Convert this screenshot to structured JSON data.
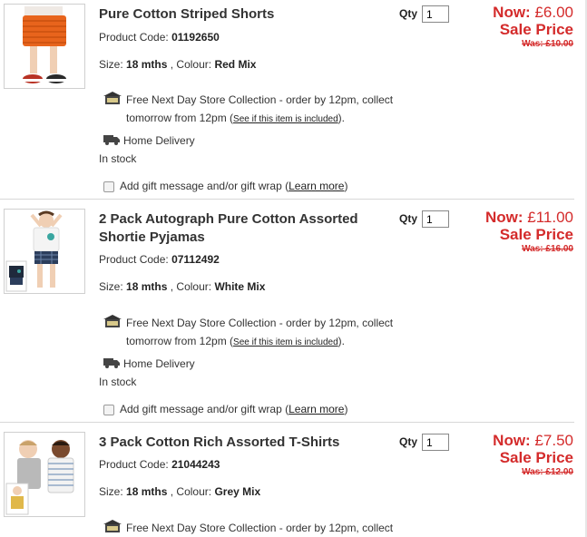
{
  "labels": {
    "qty": "Qty",
    "now": "Now:",
    "sale": "Sale Price",
    "code_label": "Product Code:",
    "size_label": "Size:",
    "colour_label": "Colour:",
    "collection_text_1": "Free Next Day Store Collection - order by 12pm, collect",
    "collection_text_2": "tomorrow from 12pm (",
    "see_link": "See if this item is included",
    "collection_close": ").",
    "home_delivery": "Home Delivery",
    "in_stock": "In stock",
    "gift_text": "Add gift message and/or gift wrap (",
    "learn_more": "Learn more",
    "gift_close": ")"
  },
  "items": [
    {
      "title": "Pure Cotton Striped Shorts",
      "code": "01192650",
      "size": "18 mths",
      "colour": "Red Mix",
      "qty": "1",
      "now_price": "£6.00",
      "was_price": "Was: £10.00"
    },
    {
      "title": "2 Pack Autograph Pure Cotton Assorted Shortie Pyjamas",
      "code": "07112492",
      "size": "18 mths",
      "colour": "White Mix",
      "qty": "1",
      "now_price": "£11.00",
      "was_price": "Was: £16.00"
    },
    {
      "title": "3 Pack Cotton Rich Assorted T-Shirts",
      "code": "21044243",
      "size": "18 mths",
      "colour": "Grey Mix",
      "qty": "1",
      "now_price": "£7.50",
      "was_price": "Was: £12.00"
    }
  ],
  "colors": {
    "price_red": "#d42b2b",
    "divider": "#d8d8d8"
  }
}
